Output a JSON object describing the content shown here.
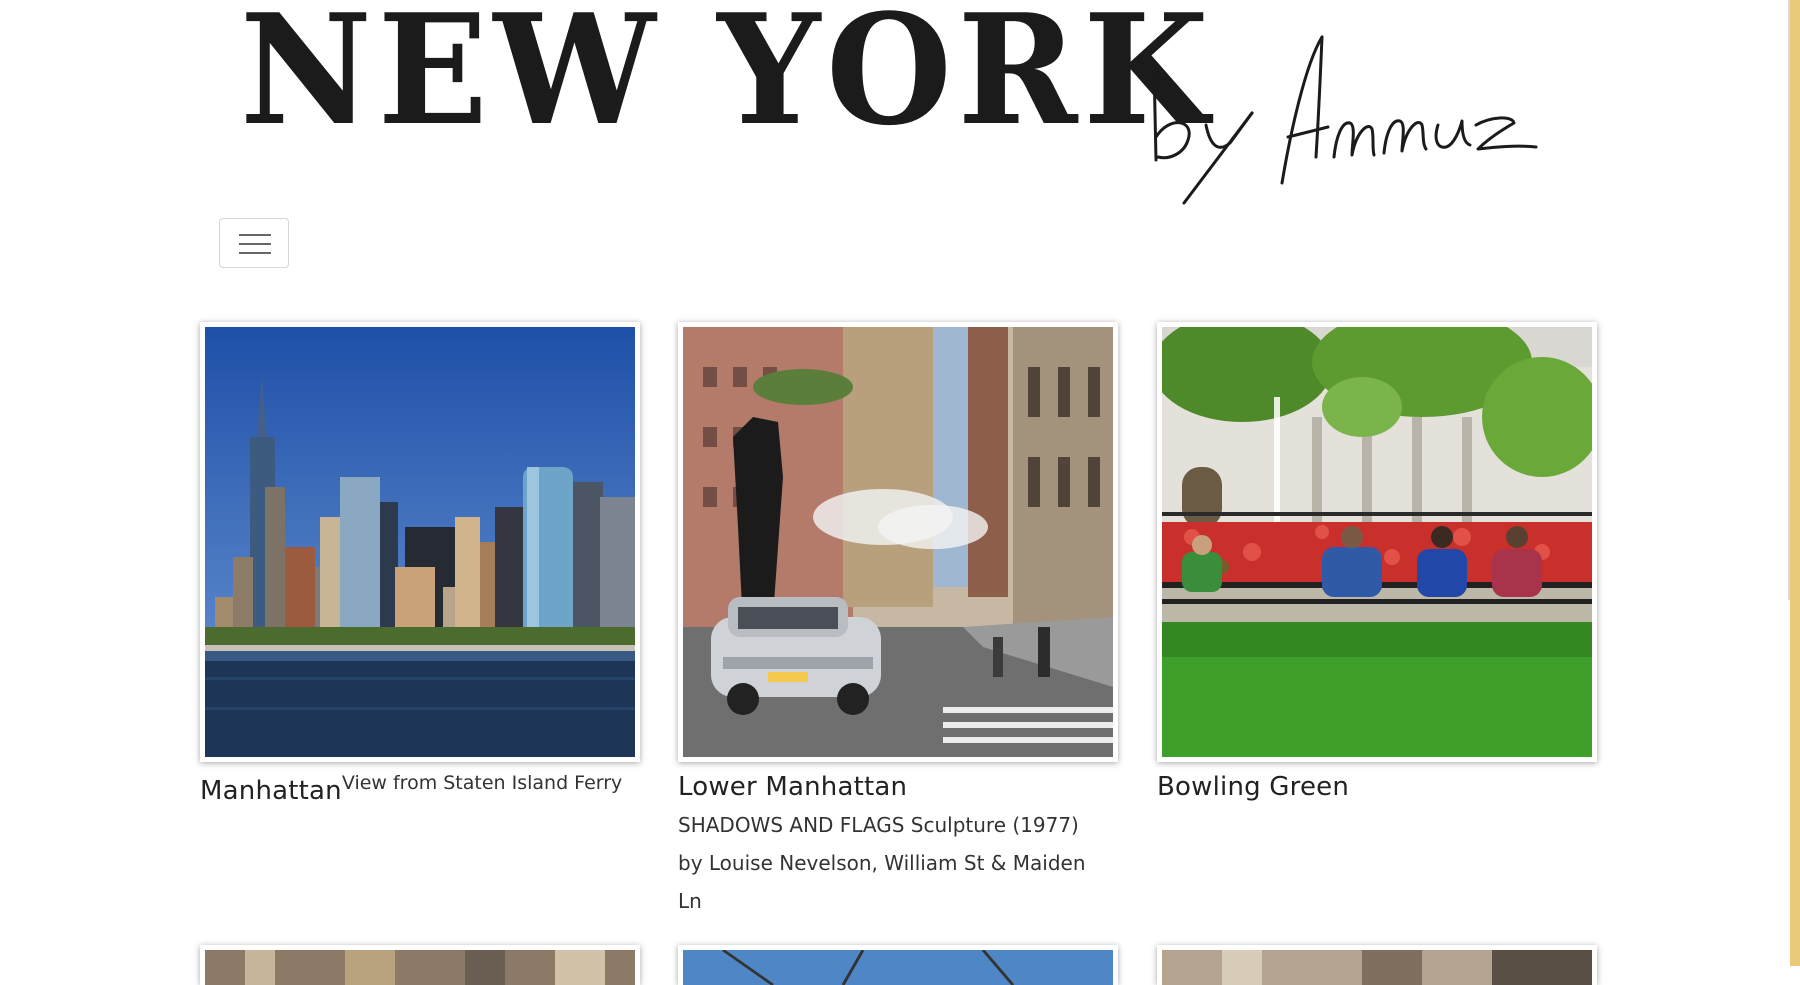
{
  "header": {
    "title": "NEW YORK",
    "signature": "by Amuz"
  },
  "nav": {
    "menu_icon": "hamburger-menu-icon"
  },
  "gallery": {
    "items": [
      {
        "title": "Manhattan",
        "subtitle": "View from Staten Island Ferry",
        "image": "manhattan-skyline-photo"
      },
      {
        "title": "Lower Manhattan",
        "description": "SHADOWS AND FLAGS Sculpture (1977) by Louise Nevelson, William St & Maiden Ln",
        "image": "lower-manhattan-street-photo"
      },
      {
        "title": "Bowling Green",
        "image": "bowling-green-park-photo"
      }
    ]
  },
  "colors": {
    "background": "#ffffff",
    "title": "#1b1b1b",
    "scrollbar": "#e9c97a"
  }
}
